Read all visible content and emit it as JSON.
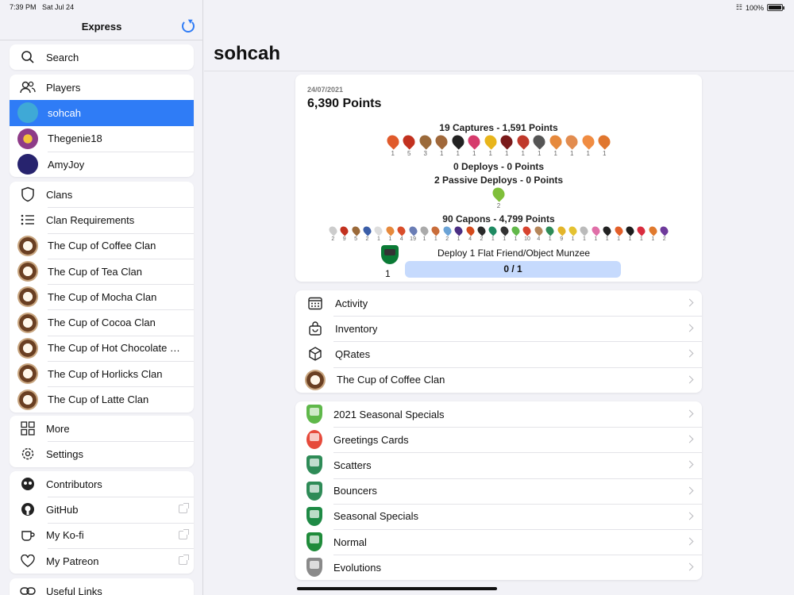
{
  "status": {
    "time": "7:39 PM",
    "date": "Sat Jul 24",
    "battery": "100%"
  },
  "sidebar": {
    "title": "Express",
    "search": "Search",
    "players_header": "Players",
    "players": [
      {
        "name": "sohcah",
        "active": true,
        "color": "#3fa9d6"
      },
      {
        "name": "Thegenie18",
        "active": false,
        "color": "#8e3b88"
      },
      {
        "name": "AmyJoy",
        "active": false,
        "color": "#27236e"
      }
    ],
    "clans_header": "Clans",
    "clan_requirements": "Clan Requirements",
    "clans": [
      "The Cup of Coffee Clan",
      "The Cup of Tea Clan",
      "The Cup of Mocha Clan",
      "The Cup of Cocoa Clan",
      "The Cup of Hot Chocolate Cl...",
      "The Cup of Horlicks Clan",
      "The Cup of Latte Clan"
    ],
    "more": "More",
    "settings": "Settings",
    "contributors": "Contributors",
    "github": "GitHub",
    "kofi": "My Ko-fi",
    "patreon": "My Patreon",
    "useful_links": "Useful Links"
  },
  "main": {
    "title": "sohcah",
    "summary": {
      "date": "24/07/2021",
      "points": "6,390 Points",
      "captures": "19 Captures - 1,591 Points",
      "capture_counts": [
        "1",
        "5",
        "3",
        "1",
        "1",
        "1",
        "1",
        "1",
        "1",
        "1",
        "1",
        "1",
        "1",
        "1"
      ],
      "capture_colors": [
        "#e05a2b",
        "#c2311f",
        "#9b6a3a",
        "#a0683a",
        "#222222",
        "#d63b6c",
        "#e8b51b",
        "#7a1a1a",
        "#c0392b",
        "#555555",
        "#e6893c",
        "#e28c4f",
        "#f08c42",
        "#e0762e"
      ],
      "deploys": "0 Deploys - 0 Points",
      "passive": "2 Passive Deploys - 0 Points",
      "passive_counts": [
        "2"
      ],
      "passive_colors": [
        "#7fbf3a"
      ],
      "capons": "90 Capons - 4,799 Points",
      "capon_counts": [
        "2",
        "9",
        "5",
        "2",
        "1",
        "1",
        "4",
        "19",
        "1",
        "1",
        "2",
        "1",
        "4",
        "2",
        "1",
        "1",
        "1",
        "10",
        "4",
        "1",
        "9",
        "1",
        "1",
        "1",
        "1",
        "1",
        "1",
        "1",
        "1",
        "2"
      ],
      "capon_colors": [
        "#cccccc",
        "#c2311f",
        "#9b6a3a",
        "#3b5ea8",
        "#dddddd",
        "#e6893c",
        "#d94d2a",
        "#6a7db5",
        "#aaaaaa",
        "#c96d3a",
        "#6ba3d6",
        "#4b2e83",
        "#d44a1c",
        "#2a2a2a",
        "#1e8a62",
        "#333333",
        "#62b84a",
        "#d7432f",
        "#b5865a",
        "#2e8b57",
        "#e3b52a",
        "#e4c232",
        "#bbbbbb",
        "#e06fa8",
        "#222222",
        "#e25f2a",
        "#1c1c1c",
        "#d92c3e",
        "#e07a2e",
        "#6e3a9b"
      ],
      "task_label": "Deploy 1 Flat Friend/Object Munzee",
      "task_count": "1",
      "task_progress": "0 / 1",
      "task_fraction": 0
    },
    "links": [
      {
        "label": "Activity",
        "icon": "calendar-icon"
      },
      {
        "label": "Inventory",
        "icon": "bag-icon"
      },
      {
        "label": "QRates",
        "icon": "cube-icon"
      },
      {
        "label": "The Cup of Coffee Clan",
        "icon": "clan-icon"
      }
    ],
    "categories": [
      {
        "label": "2021 Seasonal Specials",
        "color": "#5fb84a"
      },
      {
        "label": "Greetings Cards",
        "color": "#e64a3b"
      },
      {
        "label": "Scatters",
        "color": "#2e8b57"
      },
      {
        "label": "Bouncers",
        "color": "#2e8b57"
      },
      {
        "label": "Seasonal Specials",
        "color": "#1e8a45"
      },
      {
        "label": "Normal",
        "color": "#1f8b3a"
      },
      {
        "label": "Evolutions",
        "color": "#8a8a8a"
      }
    ]
  }
}
